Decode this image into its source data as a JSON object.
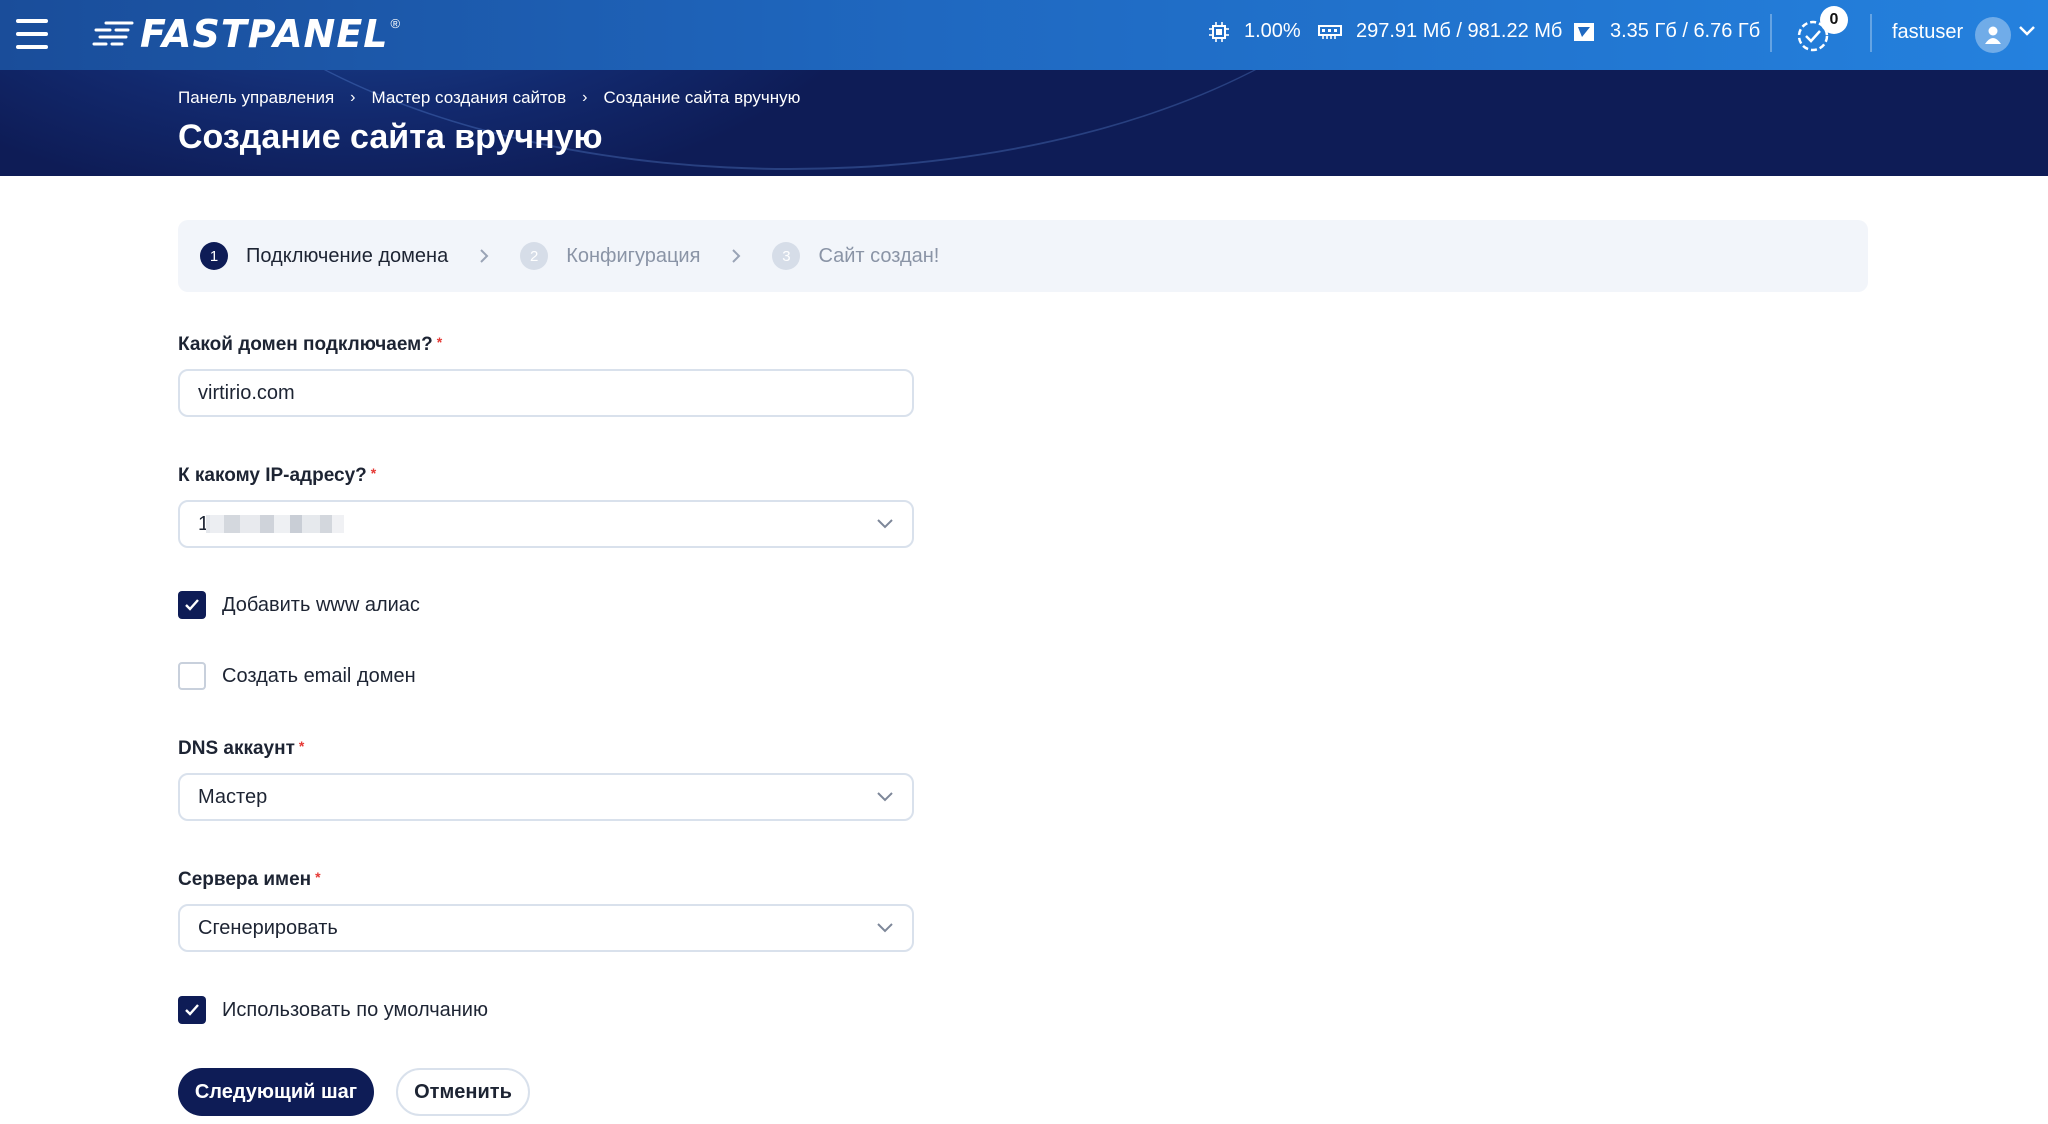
{
  "header": {
    "logo_text": "FASTPANEL",
    "logo_reg": "®",
    "cpu": "1.00%",
    "ram": "297.91 Мб / 981.22 Мб",
    "disk": "3.35 Гб / 6.76 Гб",
    "tasks_count": "0",
    "username": "fastuser"
  },
  "breadcrumb": {
    "items": [
      "Панель управления",
      "Мастер создания сайтов",
      "Создание сайта вручную"
    ],
    "separator": "›"
  },
  "page_title": "Создание сайта вручную",
  "stepper": {
    "steps": [
      {
        "num": "1",
        "label": "Подключение домена",
        "state": "active"
      },
      {
        "num": "2",
        "label": "Конфигурация",
        "state": "inactive"
      },
      {
        "num": "3",
        "label": "Сайт создан!",
        "state": "inactive"
      }
    ]
  },
  "form": {
    "domain_label": "Какой домен подключаем?",
    "domain_value": "virtirio.com",
    "ip_label": "К какому IP-адресу?",
    "ip_value_visible": "1",
    "www_alias_label": "Добавить www алиас",
    "www_alias_checked": true,
    "email_domain_label": "Создать email домен",
    "email_domain_checked": false,
    "dns_label": "DNS аккаунт",
    "dns_value": "Мастер",
    "ns_label": "Сервера имен",
    "ns_value": "Сгенерировать",
    "use_default_label": "Использовать по умолчанию",
    "use_default_checked": true,
    "required_mark": "*"
  },
  "buttons": {
    "next": "Следующий шаг",
    "cancel": "Отменить"
  },
  "colors": {
    "topbar_start": "#1a4d9a",
    "topbar_end": "#2481de",
    "navy": "#0e1c56",
    "required": "#e53935",
    "stepper_bg": "#f2f5fa"
  }
}
